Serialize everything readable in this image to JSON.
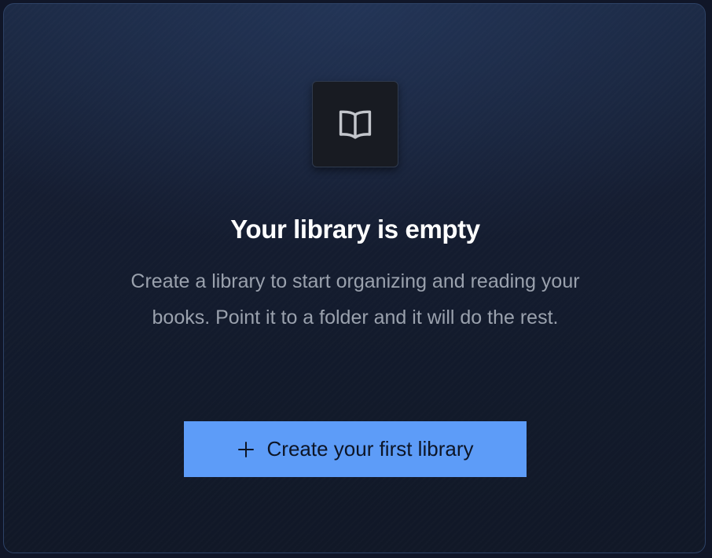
{
  "empty_state": {
    "icon": "book-open-icon",
    "title": "Your library is empty",
    "description": "Create a library to start organizing and reading your books. Point it to a folder and it will do the rest.",
    "cta": {
      "icon": "plus-icon",
      "label": "Create your first library"
    }
  },
  "colors": {
    "panel_background": "#151d31",
    "panel_border": "#2d4266",
    "icon_tile_background": "#181b22",
    "icon_color": "#c3c6cc",
    "title_color": "#ffffff",
    "description_color": "#9aa1ad",
    "button_background": "#5d9cf8",
    "button_text": "#0d1526"
  }
}
